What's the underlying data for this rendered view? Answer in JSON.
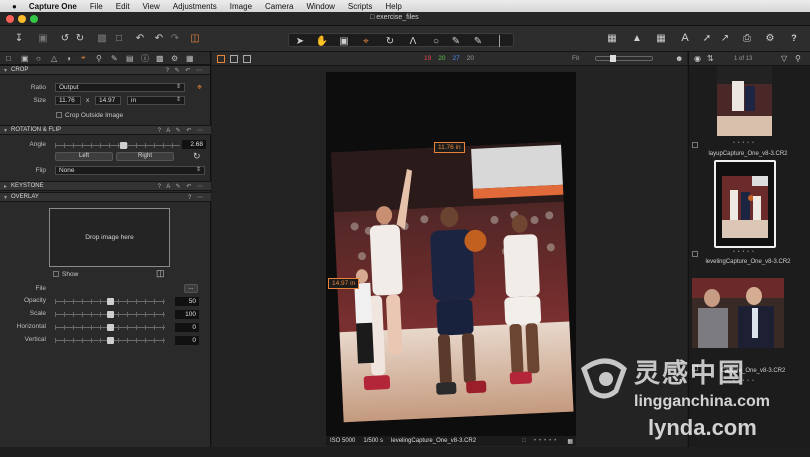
{
  "menubar": {
    "apple": "",
    "app_name": "Capture One",
    "items": [
      "File",
      "Edit",
      "View",
      "Adjustments",
      "Image",
      "Camera",
      "Window",
      "Scripts",
      "Help"
    ]
  },
  "window": {
    "title": "exercise_files"
  },
  "viewer": {
    "color_counts": [
      "19",
      "20",
      "27",
      "20"
    ],
    "color_count_colors": [
      "#e04a4a",
      "#5cc24a",
      "#4a8cf0",
      "#9b9b9b"
    ],
    "fit_label": "Fit",
    "counter": "1 of 13",
    "width_callout": "11.76 in",
    "height_callout": "14.97 in",
    "status": {
      "iso": "ISO 5000",
      "shutter": "1/500 s",
      "filename": "levelingCapture_One_v8-3.CR2"
    }
  },
  "crop": {
    "header": "CROP",
    "ratio_label": "Ratio",
    "ratio_value": "Output",
    "size_label": "Size",
    "width": "11.76",
    "times": "x",
    "height": "14.97",
    "unit": "in",
    "crop_outside_label": "Crop Outside Image"
  },
  "rotation": {
    "header": "ROTATION & FLIP",
    "angle_label": "Angle",
    "angle_value": "2.68",
    "angle_level": 0.55,
    "left_button": "Left",
    "right_button": "Right",
    "flip_label": "Flip",
    "flip_value": "None"
  },
  "keystone": {
    "header": "KEYSTONE"
  },
  "overlay": {
    "header": "OVERLAY",
    "drop_text": "Drop image here",
    "show_label": "Show",
    "file_label": "File",
    "file_button": "...",
    "rows": [
      {
        "label": "Opacity",
        "value": "50",
        "level": 0.5
      },
      {
        "label": "Scale",
        "value": "100",
        "level": 0.5
      },
      {
        "label": "Horizontal",
        "value": "0",
        "level": 0.5
      },
      {
        "label": "Vertical",
        "value": "0",
        "level": 0.5
      }
    ]
  },
  "browser": {
    "thumbnails": [
      {
        "name": "layupCapture_One_v8-3.CR2",
        "selected": false
      },
      {
        "name": "levelingCapture_One_v8-3.CR2",
        "selected": true
      },
      {
        "name": "Capture_One_v8-3.CR2",
        "selected": false
      }
    ]
  },
  "watermark": {
    "line1": "灵感中国",
    "line2": "lingganchina.com",
    "line3": "lynda.com"
  },
  "icons": [
    "import-icon",
    "camera-icon",
    "undo-icon",
    "redo-icon",
    "trash-icon",
    "cursor-icon",
    "pan-icon",
    "crop-icon",
    "rotate-icon",
    "gear-icon",
    "print-icon",
    "warning-icon",
    "grid-icon"
  ]
}
